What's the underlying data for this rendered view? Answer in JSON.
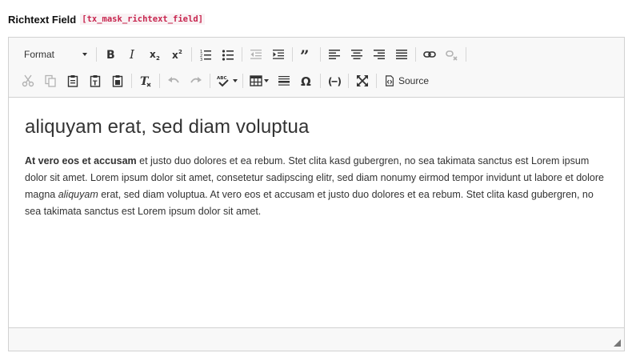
{
  "field": {
    "label": "Richtext Field",
    "code": "[tx_mask_richtext_field]"
  },
  "toolbar": {
    "format_label": "Format",
    "source_label": "Source"
  },
  "content": {
    "heading": "aliquyam erat, sed diam voluptua",
    "bold_lead": "At vero eos et accusam",
    "text_part1": " et justo duo dolores et ea rebum. Stet clita kasd gubergren, no sea takimata sanctus est Lorem ipsum dolor sit amet. Lorem ipsum dolor sit amet, consetetur sadipscing elitr, sed diam nonumy eirmod tempor invidunt ut labore et dolore magna ",
    "italic_word": "aliquyam",
    "text_part2": " erat, sed diam voluptua. At vero eos et accusam et justo duo dolores et ea rebum. Stet clita kasd gubergren, no sea takimata sanctus est Lorem ipsum dolor sit amet."
  }
}
